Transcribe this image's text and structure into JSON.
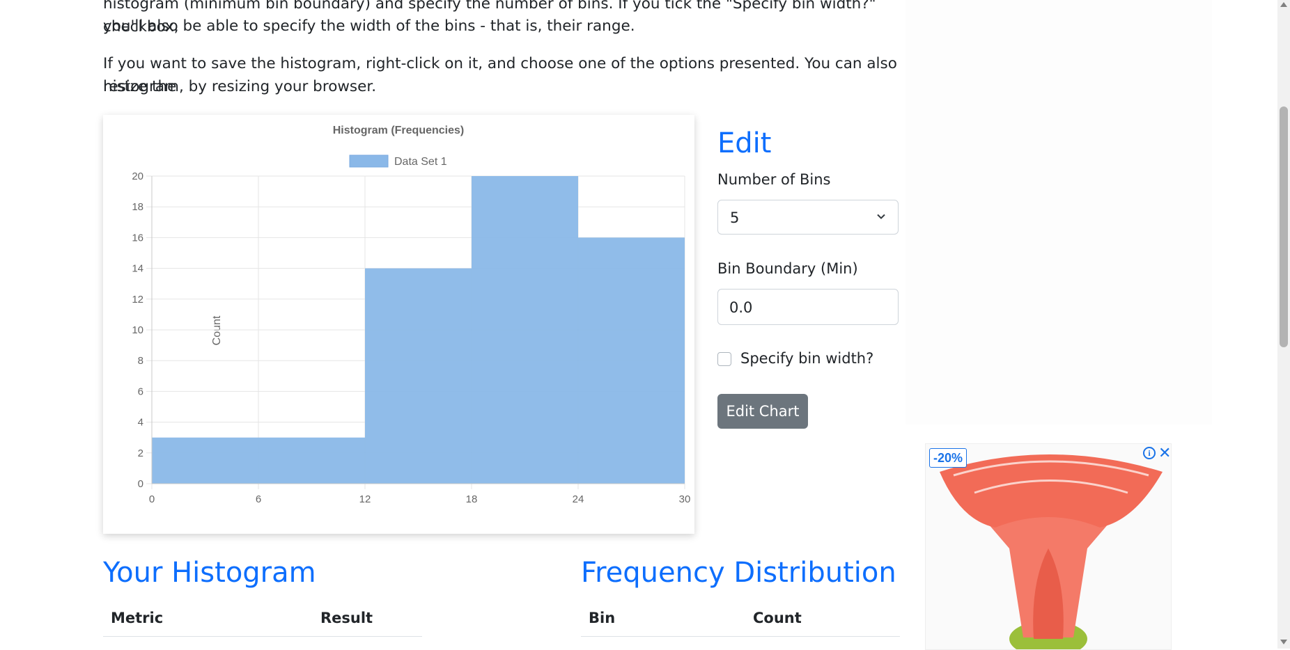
{
  "intro": {
    "line1": "histogram (minimum bin boundary) and specify the number of bins. If you tick the \"Specify bin width?\" checkbox,",
    "line2": "you'll also be able to specify the width of the bins - that is, their range.",
    "save_line1": "If you want to save the histogram, right-click on it, and choose one of the options presented. You can also resize the",
    "save_line2": "histogram, by resizing your browser."
  },
  "chart_data": {
    "type": "bar",
    "title": "Histogram (Frequencies)",
    "legend": [
      "Data Set 1"
    ],
    "legend_position": "top",
    "ylabel": "Count",
    "xlabel": "",
    "bin_edges": [
      0,
      6,
      12,
      18,
      24,
      30
    ],
    "x_ticks": [
      "0",
      "6",
      "12",
      "18",
      "24",
      "30"
    ],
    "y_ticks": [
      "0",
      "2",
      "4",
      "6",
      "8",
      "10",
      "12",
      "14",
      "16",
      "18",
      "20"
    ],
    "series": [
      {
        "name": "Data Set 1",
        "values": [
          3,
          3,
          14,
          20,
          16
        ]
      }
    ],
    "ylim": [
      0,
      20
    ],
    "xlim": [
      0,
      30
    ],
    "grid": true,
    "color": "#8ab8e8"
  },
  "edit": {
    "heading": "Edit",
    "bins_label": "Number of Bins",
    "bins_value": "5",
    "boundary_label": "Bin Boundary (Min)",
    "boundary_value": "0.0",
    "specify_width_label": "Specify bin width?",
    "specify_width_checked": false,
    "edit_button": "Edit Chart"
  },
  "your_histogram": {
    "heading": "Your Histogram",
    "col_metric": "Metric",
    "col_result": "Result"
  },
  "frequency": {
    "heading": "Frequency Distribution",
    "col_bin": "Bin",
    "col_count": "Count"
  },
  "ad": {
    "badge": "-20%",
    "info_icon": "info-icon",
    "close_icon": "close-icon",
    "accent": "#1a73e8",
    "product_color": "#f47a68"
  },
  "colors": {
    "heading": "#0d6efd",
    "button": "#6c757d"
  }
}
